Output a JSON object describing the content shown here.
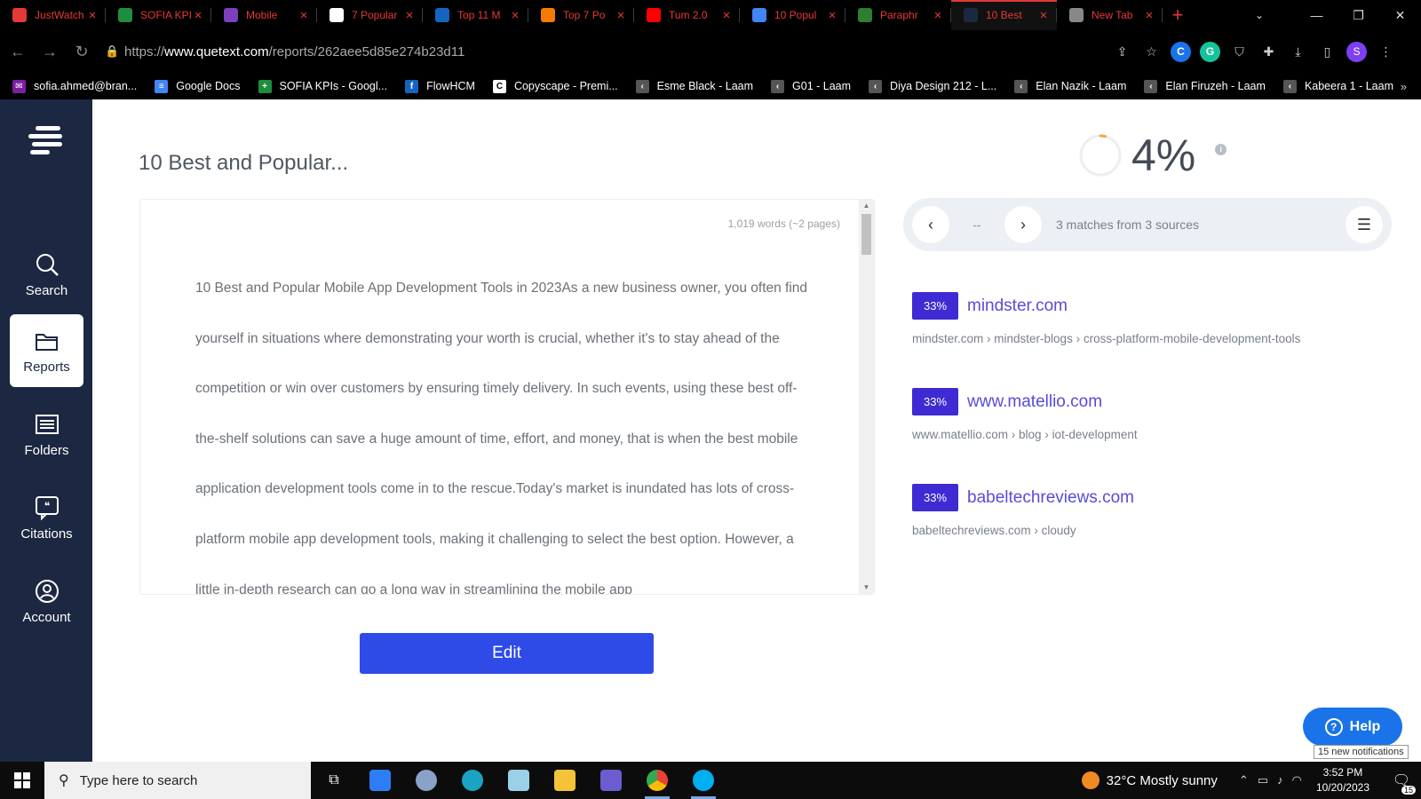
{
  "browser": {
    "tabs": [
      {
        "title": "JustWatch",
        "color": "#e53935",
        "icon": "play-icon"
      },
      {
        "title": "SOFIA KPIs",
        "color": "#1e8e3e",
        "icon": "sheets-icon"
      },
      {
        "title": "Mobile",
        "color": "#7b3fbf",
        "icon": "app-icon"
      },
      {
        "title": "7 Popular",
        "color": "#ffffff",
        "icon": "google-icon"
      },
      {
        "title": "Top 11 M",
        "color": "#1565c0",
        "icon": "globe-icon"
      },
      {
        "title": "Top 7 Po",
        "color": "#f57c00",
        "icon": "arrow-icon"
      },
      {
        "title": "Tum 2.0",
        "color": "#ff0000",
        "icon": "youtube-icon"
      },
      {
        "title": "10 Popul",
        "color": "#4285f4",
        "icon": "docs-icon"
      },
      {
        "title": "Paraphr",
        "color": "#2e7d32",
        "icon": "robot-icon"
      },
      {
        "title": "10 Best",
        "color": "#1c2841",
        "icon": "quetext-icon"
      },
      {
        "title": "New Tab",
        "color": "#888888",
        "icon": "chrome-icon"
      }
    ],
    "active_tab": 9,
    "url_prefix": "https://",
    "url_host": "www.quetext.com",
    "url_path": "/reports/262aee5d85e274b23d11",
    "profile_initial": "S",
    "bookmarks": [
      {
        "label": "sofia.ahmed@bran...",
        "color": "#7b1fa2",
        "glyph": "✉"
      },
      {
        "label": "Google Docs",
        "color": "#4285f4",
        "glyph": "≡"
      },
      {
        "label": "SOFIA KPIs - Googl...",
        "color": "#1e8e3e",
        "glyph": "+"
      },
      {
        "label": "FlowHCM",
        "color": "#1565c0",
        "glyph": "f"
      },
      {
        "label": "Copyscape - Premi...",
        "color": "#ffffff",
        "glyph": "C"
      },
      {
        "label": "Esme Black - Laam",
        "color": "#555555",
        "glyph": "‹"
      },
      {
        "label": "G01 - Laam",
        "color": "#555555",
        "glyph": "‹"
      },
      {
        "label": "Diya Design 212 - L...",
        "color": "#555555",
        "glyph": "‹"
      },
      {
        "label": "Elan Nazik - Laam",
        "color": "#555555",
        "glyph": "‹"
      },
      {
        "label": "Elan Firuzeh - Laam",
        "color": "#555555",
        "glyph": "‹"
      },
      {
        "label": "Kabeera 1 - Laam",
        "color": "#555555",
        "glyph": "‹"
      }
    ],
    "bookmarks_more": "»"
  },
  "sidebar": {
    "items": [
      {
        "label": "Search",
        "icon": "magnifier-icon"
      },
      {
        "label": "Reports",
        "icon": "folder-open-icon"
      },
      {
        "label": "Folders",
        "icon": "list-icon"
      },
      {
        "label": "Citations",
        "icon": "quote-icon"
      },
      {
        "label": "Account",
        "icon": "user-icon"
      }
    ],
    "active": 1
  },
  "report": {
    "title": "10 Best and Popular...",
    "word_count": "1,019 words (~2 pages)",
    "body": "10 Best and Popular Mobile App Development Tools in 2023As a new business owner, you often find yourself in situations where demonstrating your worth is crucial, whether it's to stay ahead of the competition or win over customers by ensuring timely delivery. In such events, using these best off-the-shelf solutions can save a huge amount of time, effort, and money, that is when the best mobile application development tools come in to the rescue.Today's market is inundated has lots of cross-platform mobile app development tools, making it challenging to select the best option. However, a little in-depth research can go a long way in streamlining the mobile app",
    "edit_label": "Edit",
    "score_value": 0.04,
    "score_label": "4%",
    "info_glyph": "i",
    "match_index": "--",
    "matches_summary": "3 matches from 3 sources"
  },
  "sources": [
    {
      "percent": "33%",
      "domain": "mindster.com",
      "crumb": [
        "mindster.com",
        "mindster-blogs",
        "cross-platform-mobile-development-tools"
      ]
    },
    {
      "percent": "33%",
      "domain": "www.matellio.com",
      "crumb": [
        "www.matellio.com",
        "blog",
        "iot-development"
      ]
    },
    {
      "percent": "33%",
      "domain": "babeltechreviews.com",
      "crumb": [
        "babeltechreviews.com",
        "cloudy"
      ]
    }
  ],
  "help": {
    "label": "Help",
    "tooltip": "15 new notifications"
  },
  "taskbar": {
    "search_placeholder": "Type here to search",
    "weather": "32°C  Mostly sunny",
    "time": "3:52 PM",
    "date": "10/20/2023",
    "notification_count": "15"
  },
  "colors": {
    "sidebar": "#1c2841",
    "accent_blue": "#2e4be8",
    "badge_purple": "#3f2bd4",
    "link_purple": "#5a4bd8"
  }
}
